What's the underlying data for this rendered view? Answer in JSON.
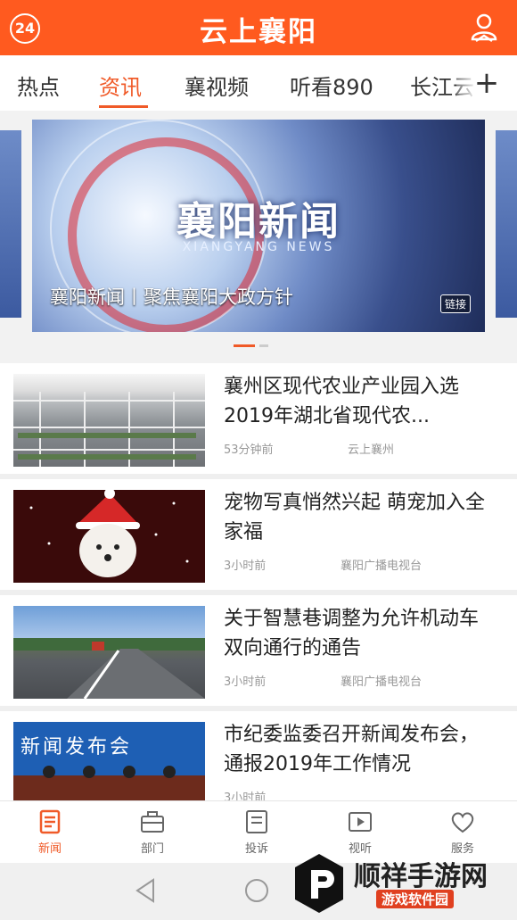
{
  "header": {
    "title": "云上襄阳",
    "left_badge": "24",
    "right_icon": "user-profile-icon"
  },
  "tabs": [
    {
      "label": "热点"
    },
    {
      "label": "资讯"
    },
    {
      "label": "襄视频"
    },
    {
      "label": "听看890"
    },
    {
      "label": "长江云"
    }
  ],
  "tabs_more": "+",
  "banner": {
    "logo": "襄阳新闻",
    "logo_sub": "XIANGYANG NEWS",
    "caption": "襄阳新闻丨聚焦襄阳大政方针",
    "tag": "链接"
  },
  "news": [
    {
      "title": "襄州区现代农业产业园入选2019年湖北省现代农...",
      "time": "53分钟前",
      "source": "云上襄州"
    },
    {
      "title": "宠物写真悄然兴起 萌宠加入全家福",
      "time": "3小时前",
      "source": "襄阳广播电视台"
    },
    {
      "title": "关于智慧巷调整为允许机动车双向通行的通告",
      "time": "3小时前",
      "source": "襄阳广播电视台"
    },
    {
      "title": "市纪委监委召开新闻发布会，通报2019年工作情况",
      "time": "3小时前",
      "source": ""
    }
  ],
  "thumb4_text": "新闻发布会",
  "nav": [
    {
      "label": "新闻",
      "icon": "news-icon"
    },
    {
      "label": "部门",
      "icon": "department-icon"
    },
    {
      "label": "投诉",
      "icon": "complaint-icon"
    },
    {
      "label": "视听",
      "icon": "video-icon"
    },
    {
      "label": "服务",
      "icon": "heart-icon"
    }
  ],
  "watermark": {
    "text": "顺祥手游网",
    "sub": "游戏软件园"
  },
  "colors": {
    "accent": "#f05a28",
    "header": "#ff5a1f"
  }
}
